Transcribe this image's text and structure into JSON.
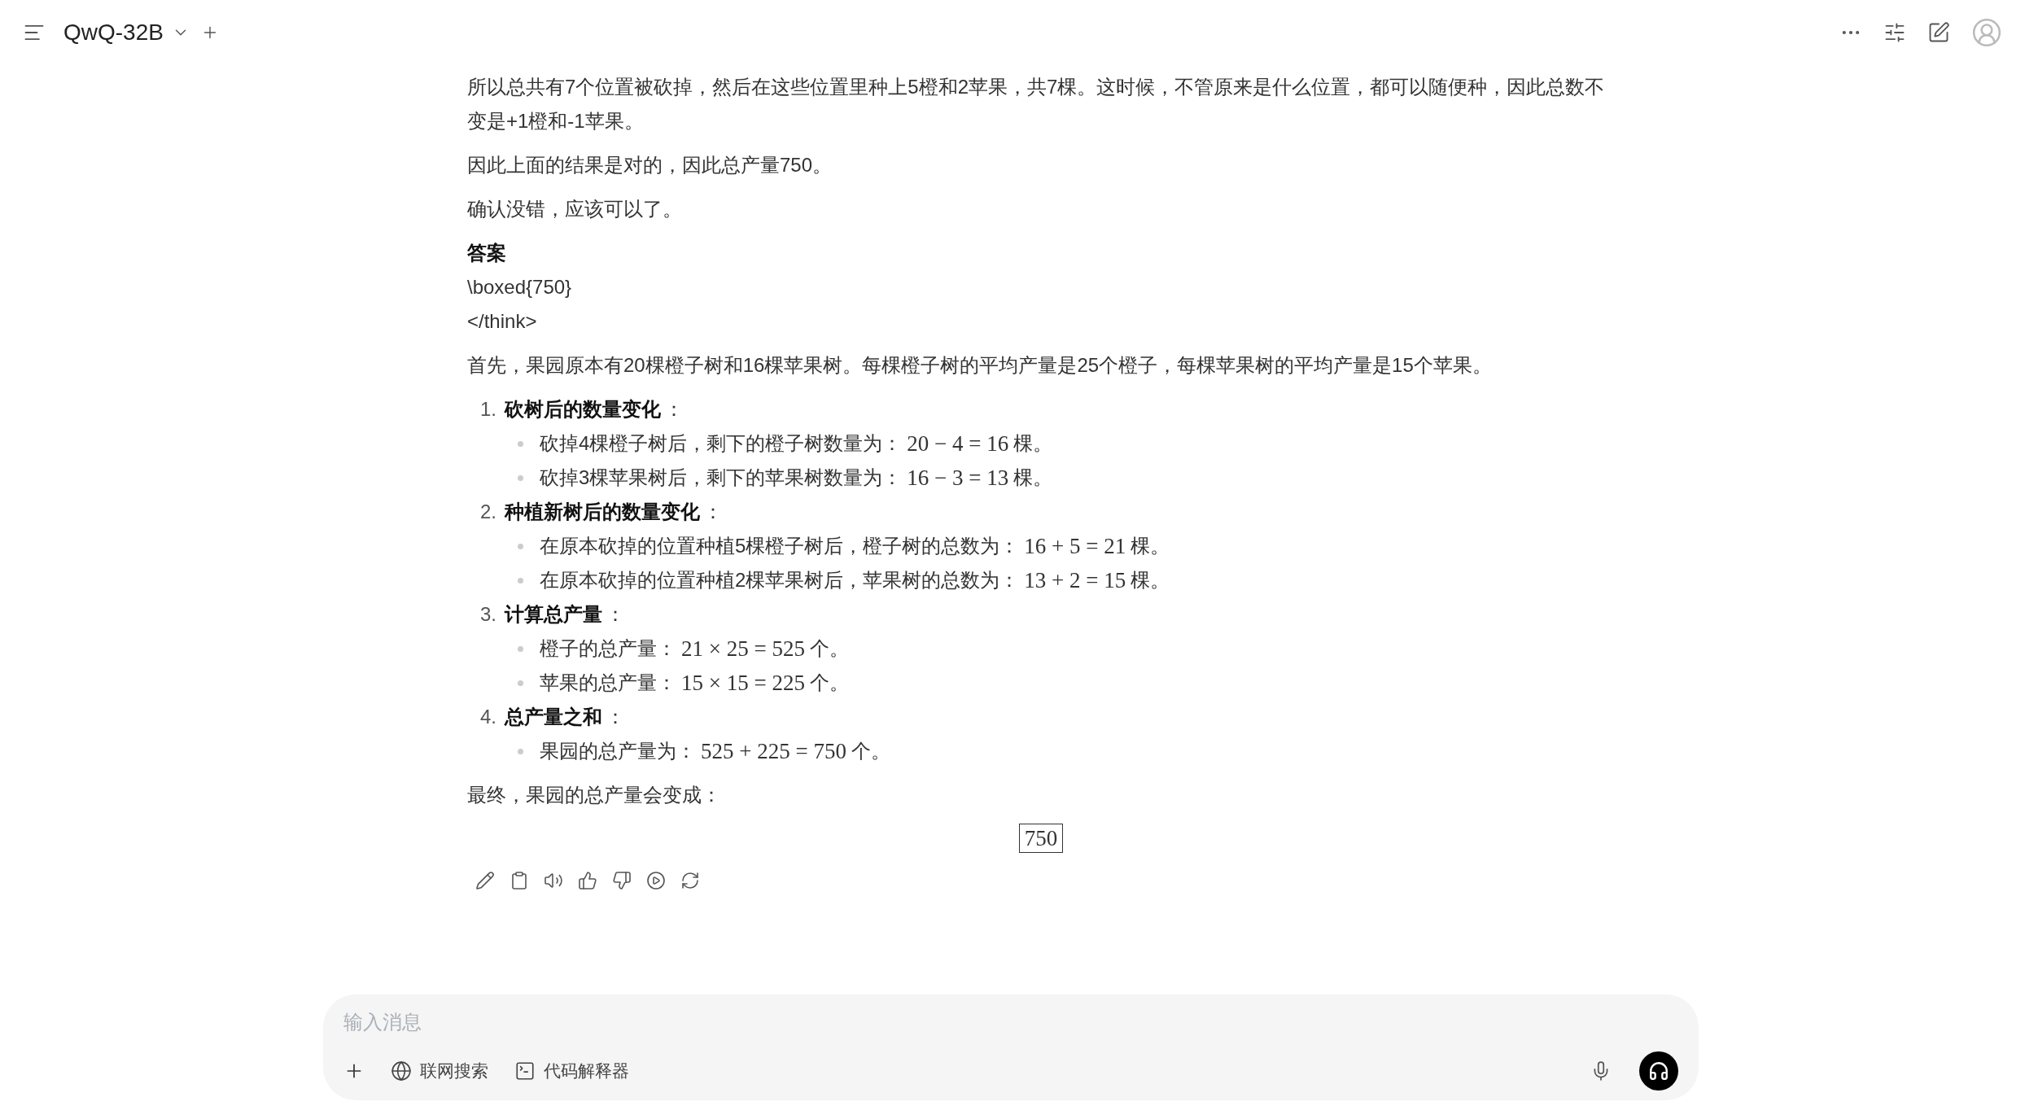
{
  "header": {
    "model": "QwQ-32B"
  },
  "paragraphs": [
    "所以总共有7个位置被砍掉，然后在这些位置里种上5橙和2苹果，共7棵。这时候，不管原来是什么位置，都可以随便种，因此总数不变是+1橙和-1苹果。",
    "因此上面的结果是对的，因此总产量750。",
    "确认没错，应该可以了。"
  ],
  "answer_heading": "答案",
  "answer_lines": [
    "\\boxed{750}",
    "</think>"
  ],
  "intro": "首先，果园原本有20棵橙子树和16棵苹果树。每棵橙子树的平均产量是25个橙子，每棵苹果树的平均产量是15个苹果。",
  "steps": [
    {
      "number": "1.",
      "title": "砍树后的数量变化",
      "colon": "：",
      "bullets": [
        {
          "text": "砍掉4棵橙子树后，剩下的橙子树数量为：",
          "math": "20 − 4 = 16",
          "unit": "棵。"
        },
        {
          "text": "砍掉3棵苹果树后，剩下的苹果树数量为：",
          "math": "16 − 3 = 13",
          "unit": "棵。"
        }
      ]
    },
    {
      "number": "2.",
      "title": "种植新树后的数量变化",
      "colon": "：",
      "bullets": [
        {
          "text": "在原本砍掉的位置种植5棵橙子树后，橙子树的总数为：",
          "math": "16 + 5 = 21",
          "unit": "棵。"
        },
        {
          "text": "在原本砍掉的位置种植2棵苹果树后，苹果树的总数为：",
          "math": "13 + 2 = 15",
          "unit": "棵。"
        }
      ]
    },
    {
      "number": "3.",
      "title": "计算总产量",
      "colon": "：",
      "bullets": [
        {
          "text": "橙子的总产量：",
          "math": "21 × 25 = 525",
          "unit": "个。"
        },
        {
          "text": "苹果的总产量：",
          "math": "15 × 15 = 225",
          "unit": "个。"
        }
      ]
    },
    {
      "number": "4.",
      "title": "总产量之和",
      "colon": "：",
      "bullets": [
        {
          "text": "果园的总产量为：",
          "math": "525 + 225 = 750",
          "unit": "个。"
        }
      ]
    }
  ],
  "conclusion": "最终，果园的总产量会变成：",
  "boxed_result": "750",
  "input": {
    "placeholder": "输入消息",
    "tools": [
      {
        "kind": "globe",
        "label": "联网搜索"
      },
      {
        "kind": "terminal",
        "label": "代码解释器"
      }
    ]
  }
}
